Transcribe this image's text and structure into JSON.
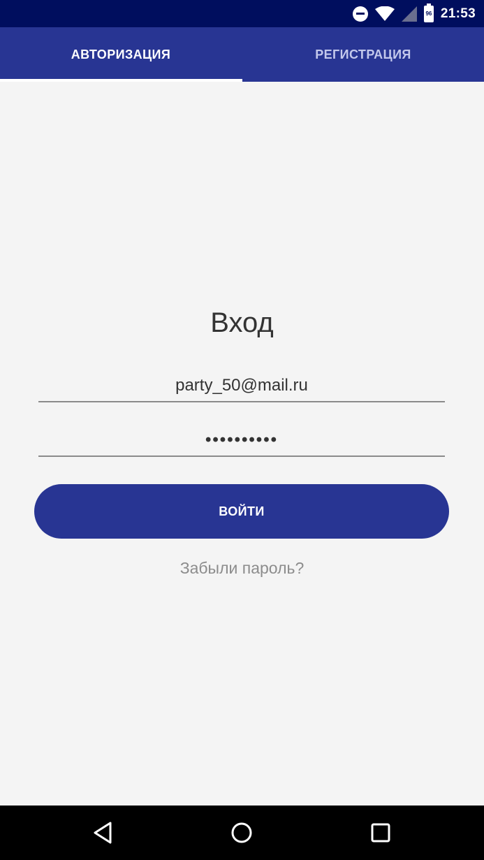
{
  "status_bar": {
    "time": "21:53",
    "battery_level": "96",
    "icons": [
      "do-not-disturb-icon",
      "wifi-icon",
      "cell-signal-icon",
      "battery-icon"
    ]
  },
  "tabs": [
    {
      "label": "АВТОРИЗАЦИЯ",
      "selected": true
    },
    {
      "label": "РЕГИСТРАЦИЯ",
      "selected": false
    }
  ],
  "login_form": {
    "title": "Вход",
    "email_value": "party_50@mail.ru",
    "password_value": "••••••••••",
    "submit_label": "ВОЙТИ",
    "forgot_password_label": "Забыли пароль?"
  },
  "nav_bar": {
    "icons": [
      "back-icon",
      "home-icon",
      "recents-icon"
    ]
  },
  "colors": {
    "primary": "#283593",
    "status_bar": "#000e5e",
    "background": "#f4f4f4"
  }
}
